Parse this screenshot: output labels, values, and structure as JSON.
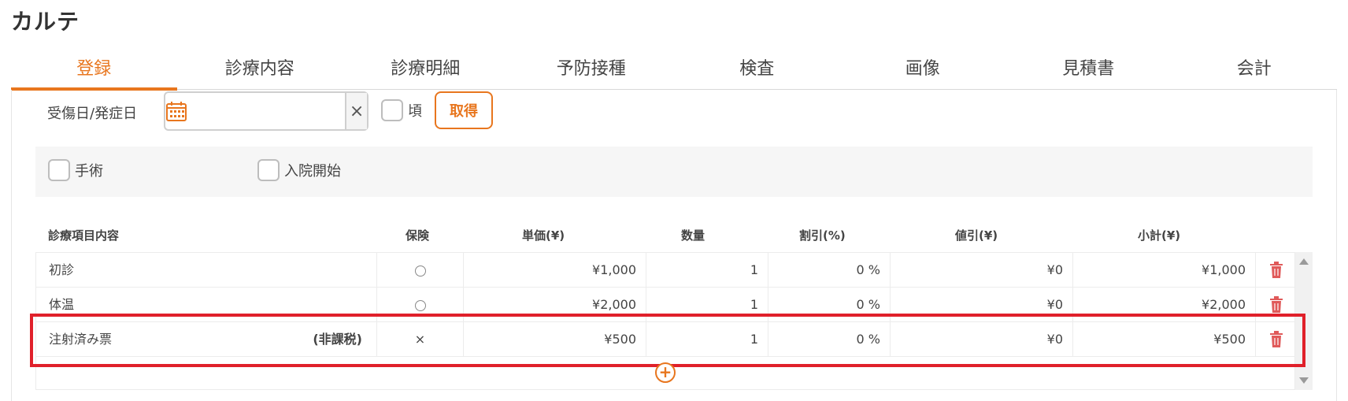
{
  "page": {
    "title": "カルテ"
  },
  "tabs": [
    {
      "label": "登録",
      "active": true
    },
    {
      "label": "診療内容",
      "active": false
    },
    {
      "label": "診療明細",
      "active": false
    },
    {
      "label": "予防接種",
      "active": false
    },
    {
      "label": "検査",
      "active": false
    },
    {
      "label": "画像",
      "active": false
    },
    {
      "label": "見積書",
      "active": false
    },
    {
      "label": "会計",
      "active": false
    }
  ],
  "injury": {
    "label": "受傷日/発症日",
    "date_value": "",
    "clear_symbol": "×",
    "approx_label": "頃",
    "get_label": "取得"
  },
  "options": {
    "surgery_label": "手術",
    "admission_label": "入院開始"
  },
  "grid": {
    "headers": [
      "診療項目内容",
      "保険",
      "単価(¥)",
      "数量",
      "割引(%)",
      "値引(¥)",
      "小計(¥)"
    ],
    "rows": [
      {
        "name": "初診",
        "tax": "",
        "insurance": "circle",
        "price": "¥1,000",
        "qty": "1",
        "discount": "0 %",
        "off": "¥0",
        "subtotal": "¥1,000"
      },
      {
        "name": "体温",
        "tax": "",
        "insurance": "circle",
        "price": "¥2,000",
        "qty": "1",
        "discount": "0 %",
        "off": "¥0",
        "subtotal": "¥2,000"
      },
      {
        "name": "注射済み票",
        "tax": "(非課税)",
        "insurance": "×",
        "price": "¥500",
        "qty": "1",
        "discount": "0 %",
        "off": "¥0",
        "subtotal": "¥500"
      }
    ]
  },
  "add_symbol": "+",
  "colors": {
    "accent": "#e8761e",
    "highlight": "#e0202a",
    "delete": "#e05a5a"
  }
}
